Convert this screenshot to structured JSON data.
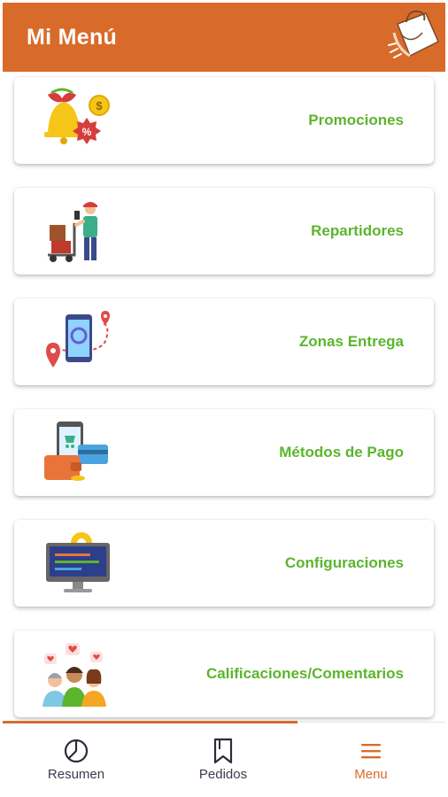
{
  "header": {
    "title": "Mi Menú"
  },
  "menu_items": [
    {
      "label": "Promociones",
      "icon": "promotion-bell-icon"
    },
    {
      "label": "Repartidores",
      "icon": "delivery-person-icon"
    },
    {
      "label": "Zonas Entrega",
      "icon": "delivery-zone-map-icon"
    },
    {
      "label": "Métodos de Pago",
      "icon": "payment-methods-icon"
    },
    {
      "label": "Configuraciones",
      "icon": "settings-monitor-icon"
    },
    {
      "label": "Calificaciones/Comentarios",
      "icon": "ratings-comments-icon"
    }
  ],
  "bottom_nav": {
    "tabs": [
      {
        "label": "Resumen",
        "icon": "pie-chart-icon"
      },
      {
        "label": "Pedidos",
        "icon": "bookmark-icon"
      },
      {
        "label": "Menu",
        "icon": "hamburger-menu-icon",
        "active": true
      }
    ]
  },
  "colors": {
    "brand_orange": "#d96b2a",
    "label_green": "#5bb52d",
    "nav_text": "#3b3b4f"
  }
}
